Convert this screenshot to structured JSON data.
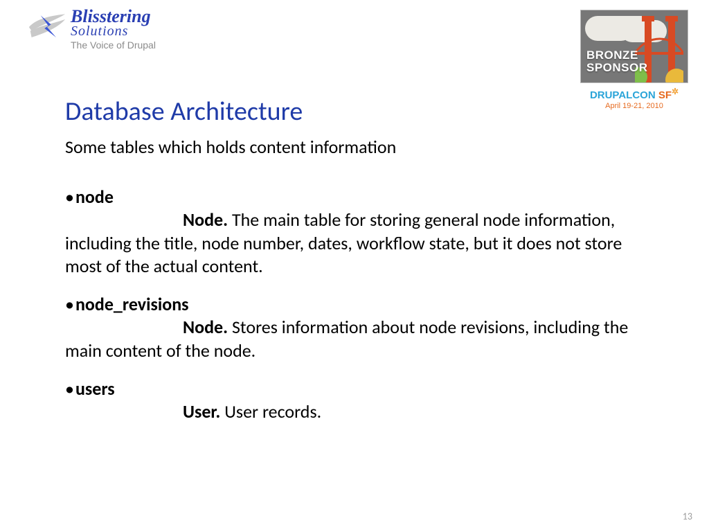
{
  "logo": {
    "line1": "Blisstering",
    "line2": "Solutions",
    "tagline": "The Voice of Drupal"
  },
  "badge": {
    "line1": "BRONZE",
    "line2": "SPONSOR",
    "conf_prefix": "DRUPALCON",
    "conf_suffix": " SF",
    "gear": "✲",
    "date": "April 19-21, 2010"
  },
  "title": "Database Architecture",
  "subtitle": "Some tables which holds content information",
  "items": [
    {
      "name": "node",
      "lead": "Node.",
      "desc_first": " The main table for storing general node",
      "desc_rest": "information, including the title, node number, dates, workflow state, but it does not store most of the actual content."
    },
    {
      "name": "node_revisions",
      "lead": "Node.",
      "desc_first": " Stores information about node revisions,",
      "desc_rest": "including the main content of the node."
    },
    {
      "name": "users",
      "lead": "User.",
      "desc_first": " User records.",
      "desc_rest": ""
    }
  ],
  "page_number": "13"
}
